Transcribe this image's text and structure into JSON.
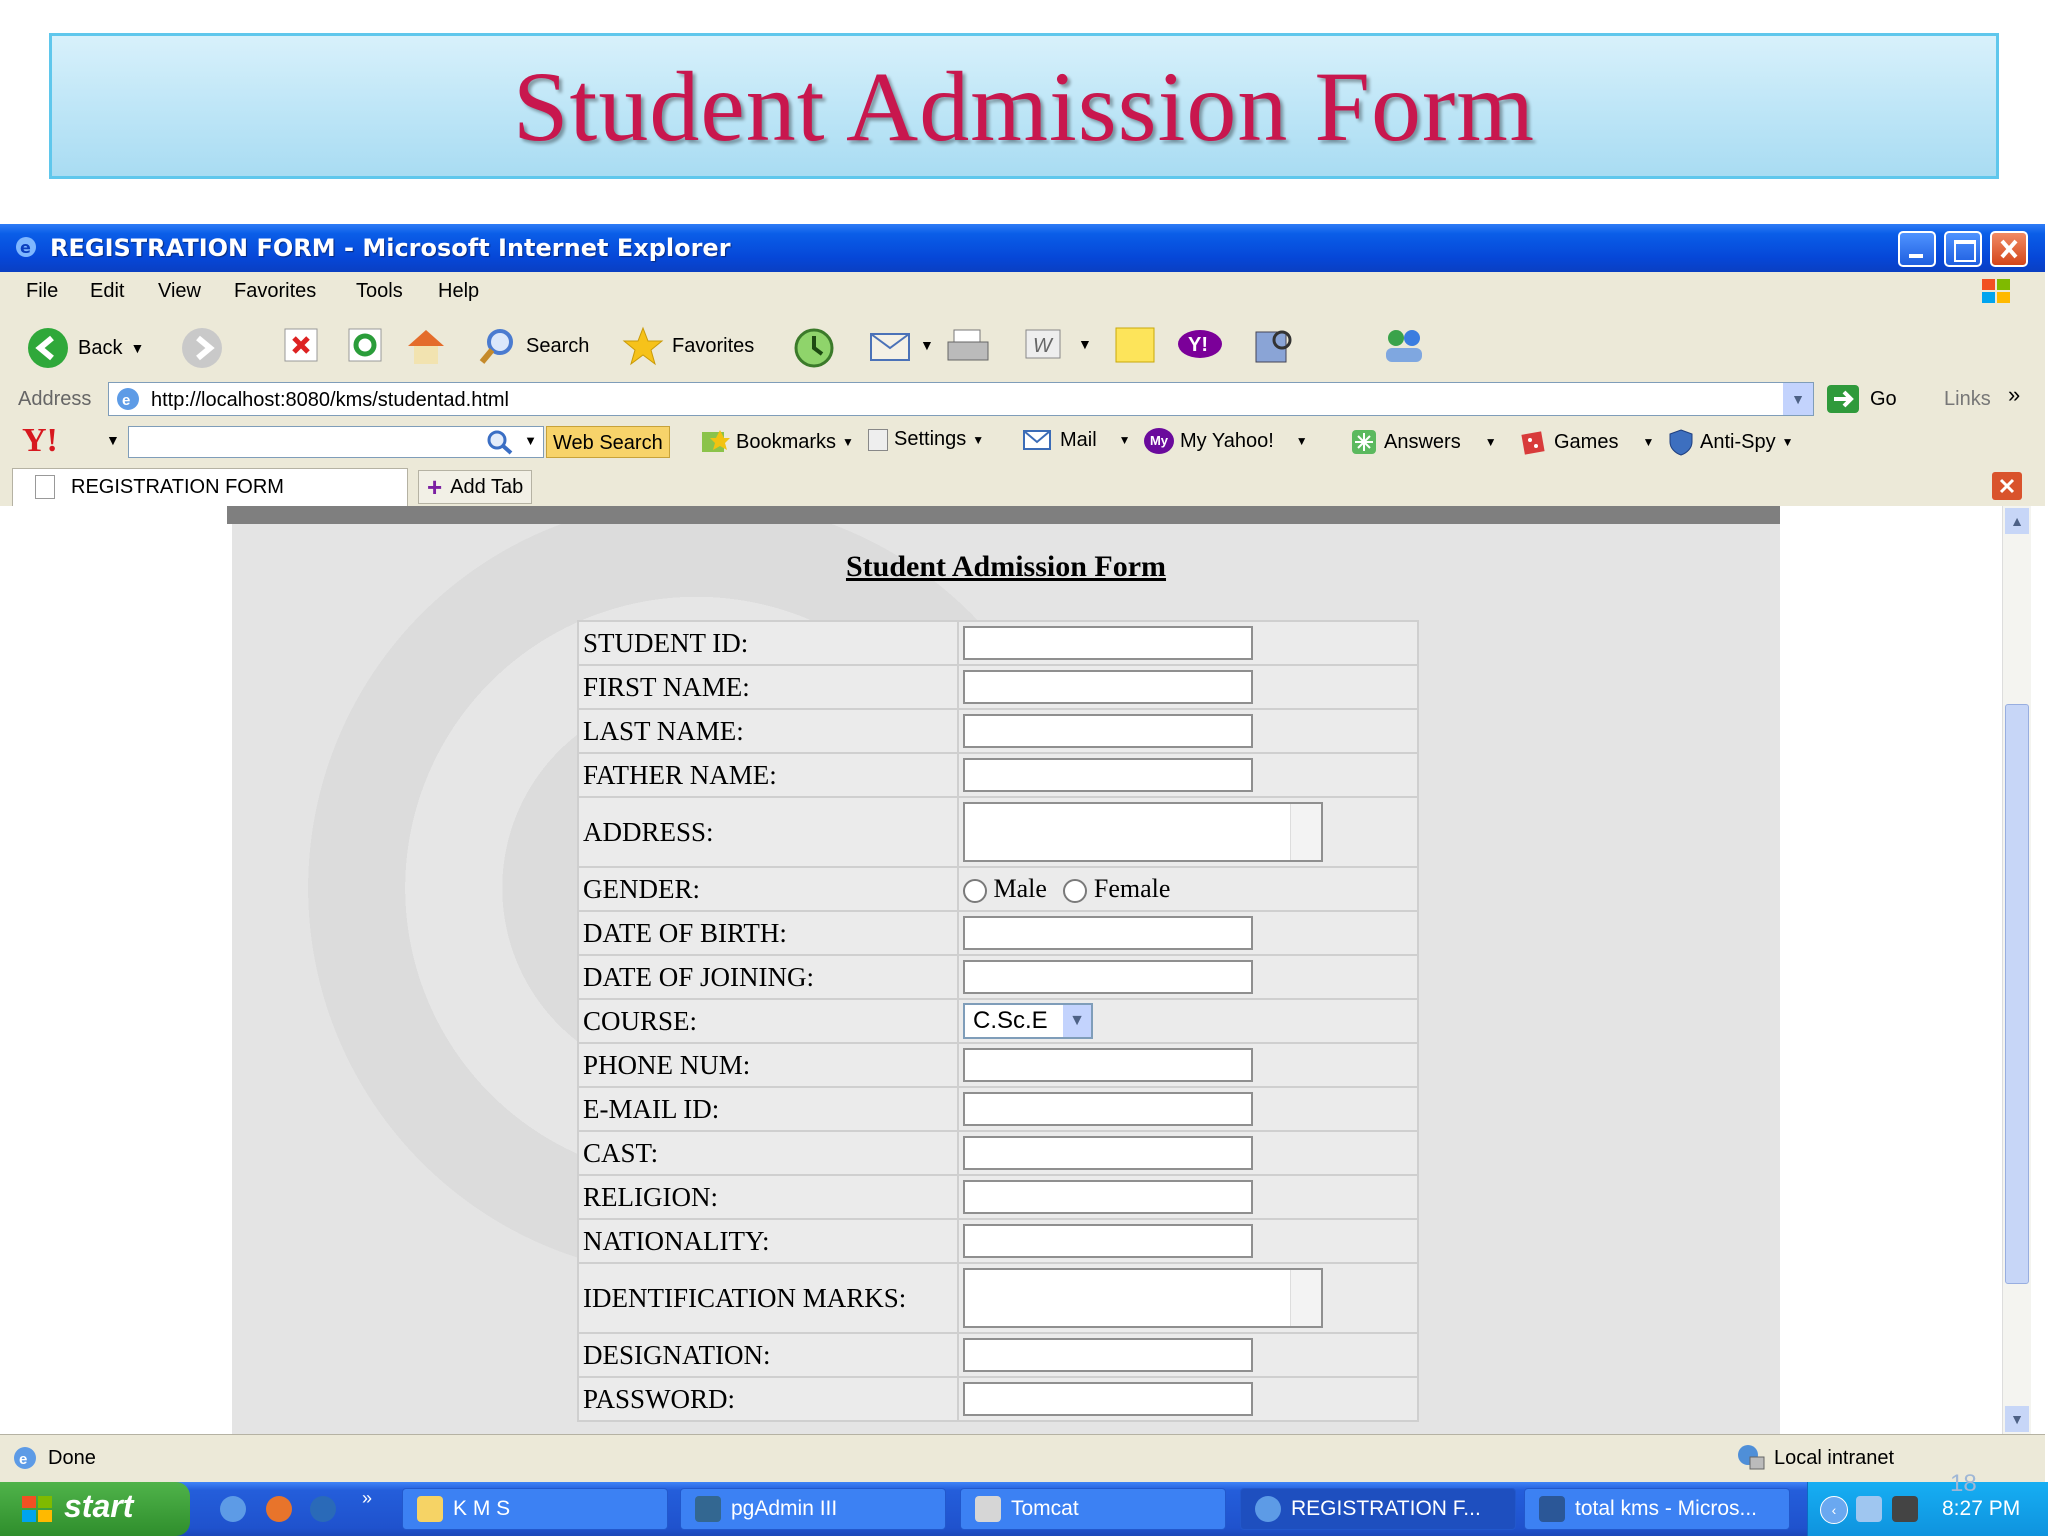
{
  "slide": {
    "title": "Student Admission Form",
    "page_number": "18"
  },
  "window": {
    "title": "REGISTRATION FORM - Microsoft Internet Explorer",
    "menu": [
      "File",
      "Edit",
      "View",
      "Favorites",
      "Tools",
      "Help"
    ],
    "toolbar": {
      "back": "Back",
      "search": "Search",
      "favorites": "Favorites"
    },
    "address": {
      "label": "Address",
      "url": "http://localhost:8080/kms/studentad.html",
      "go": "Go",
      "links": "Links"
    },
    "yahoo": {
      "web_search": "Web Search",
      "bookmarks": "Bookmarks",
      "settings": "Settings",
      "mail": "Mail",
      "my_yahoo": "My Yahoo!",
      "answers": "Answers",
      "games": "Games",
      "antispy": "Anti-Spy"
    },
    "tab": {
      "label": "REGISTRATION FORM",
      "add_tab": "Add Tab"
    },
    "status": {
      "text": "Done",
      "zone": "Local intranet"
    }
  },
  "form": {
    "heading": "Student Admission Form",
    "fields": [
      {
        "label": "STUDENT ID:"
      },
      {
        "label": "FIRST NAME:"
      },
      {
        "label": "LAST NAME:"
      },
      {
        "label": "FATHER NAME:"
      },
      {
        "label": "ADDRESS:"
      },
      {
        "label": "GENDER:"
      },
      {
        "label": "DATE OF BIRTH:"
      },
      {
        "label": "DATE OF JOINING:"
      },
      {
        "label": "COURSE:"
      },
      {
        "label": "PHONE NUM:"
      },
      {
        "label": "E-MAIL ID:"
      },
      {
        "label": "CAST:"
      },
      {
        "label": "RELIGION:"
      },
      {
        "label": "NATIONALITY:"
      },
      {
        "label": "IDENTIFICATION MARKS:"
      },
      {
        "label": "DESIGNATION:"
      },
      {
        "label": "PASSWORD:"
      }
    ],
    "gender_options": [
      "Male",
      "Female"
    ],
    "course_value": "C.Sc.E"
  },
  "taskbar": {
    "start": "start",
    "tasks": [
      "K M S",
      "pgAdmin III",
      "Tomcat",
      "REGISTRATION F...",
      "total kms - Micros..."
    ],
    "clock": "8:27 PM"
  },
  "colors": {
    "banner_title": "#c8174e",
    "titlebar": "#0a5ee8",
    "taskbar": "#245edb"
  }
}
